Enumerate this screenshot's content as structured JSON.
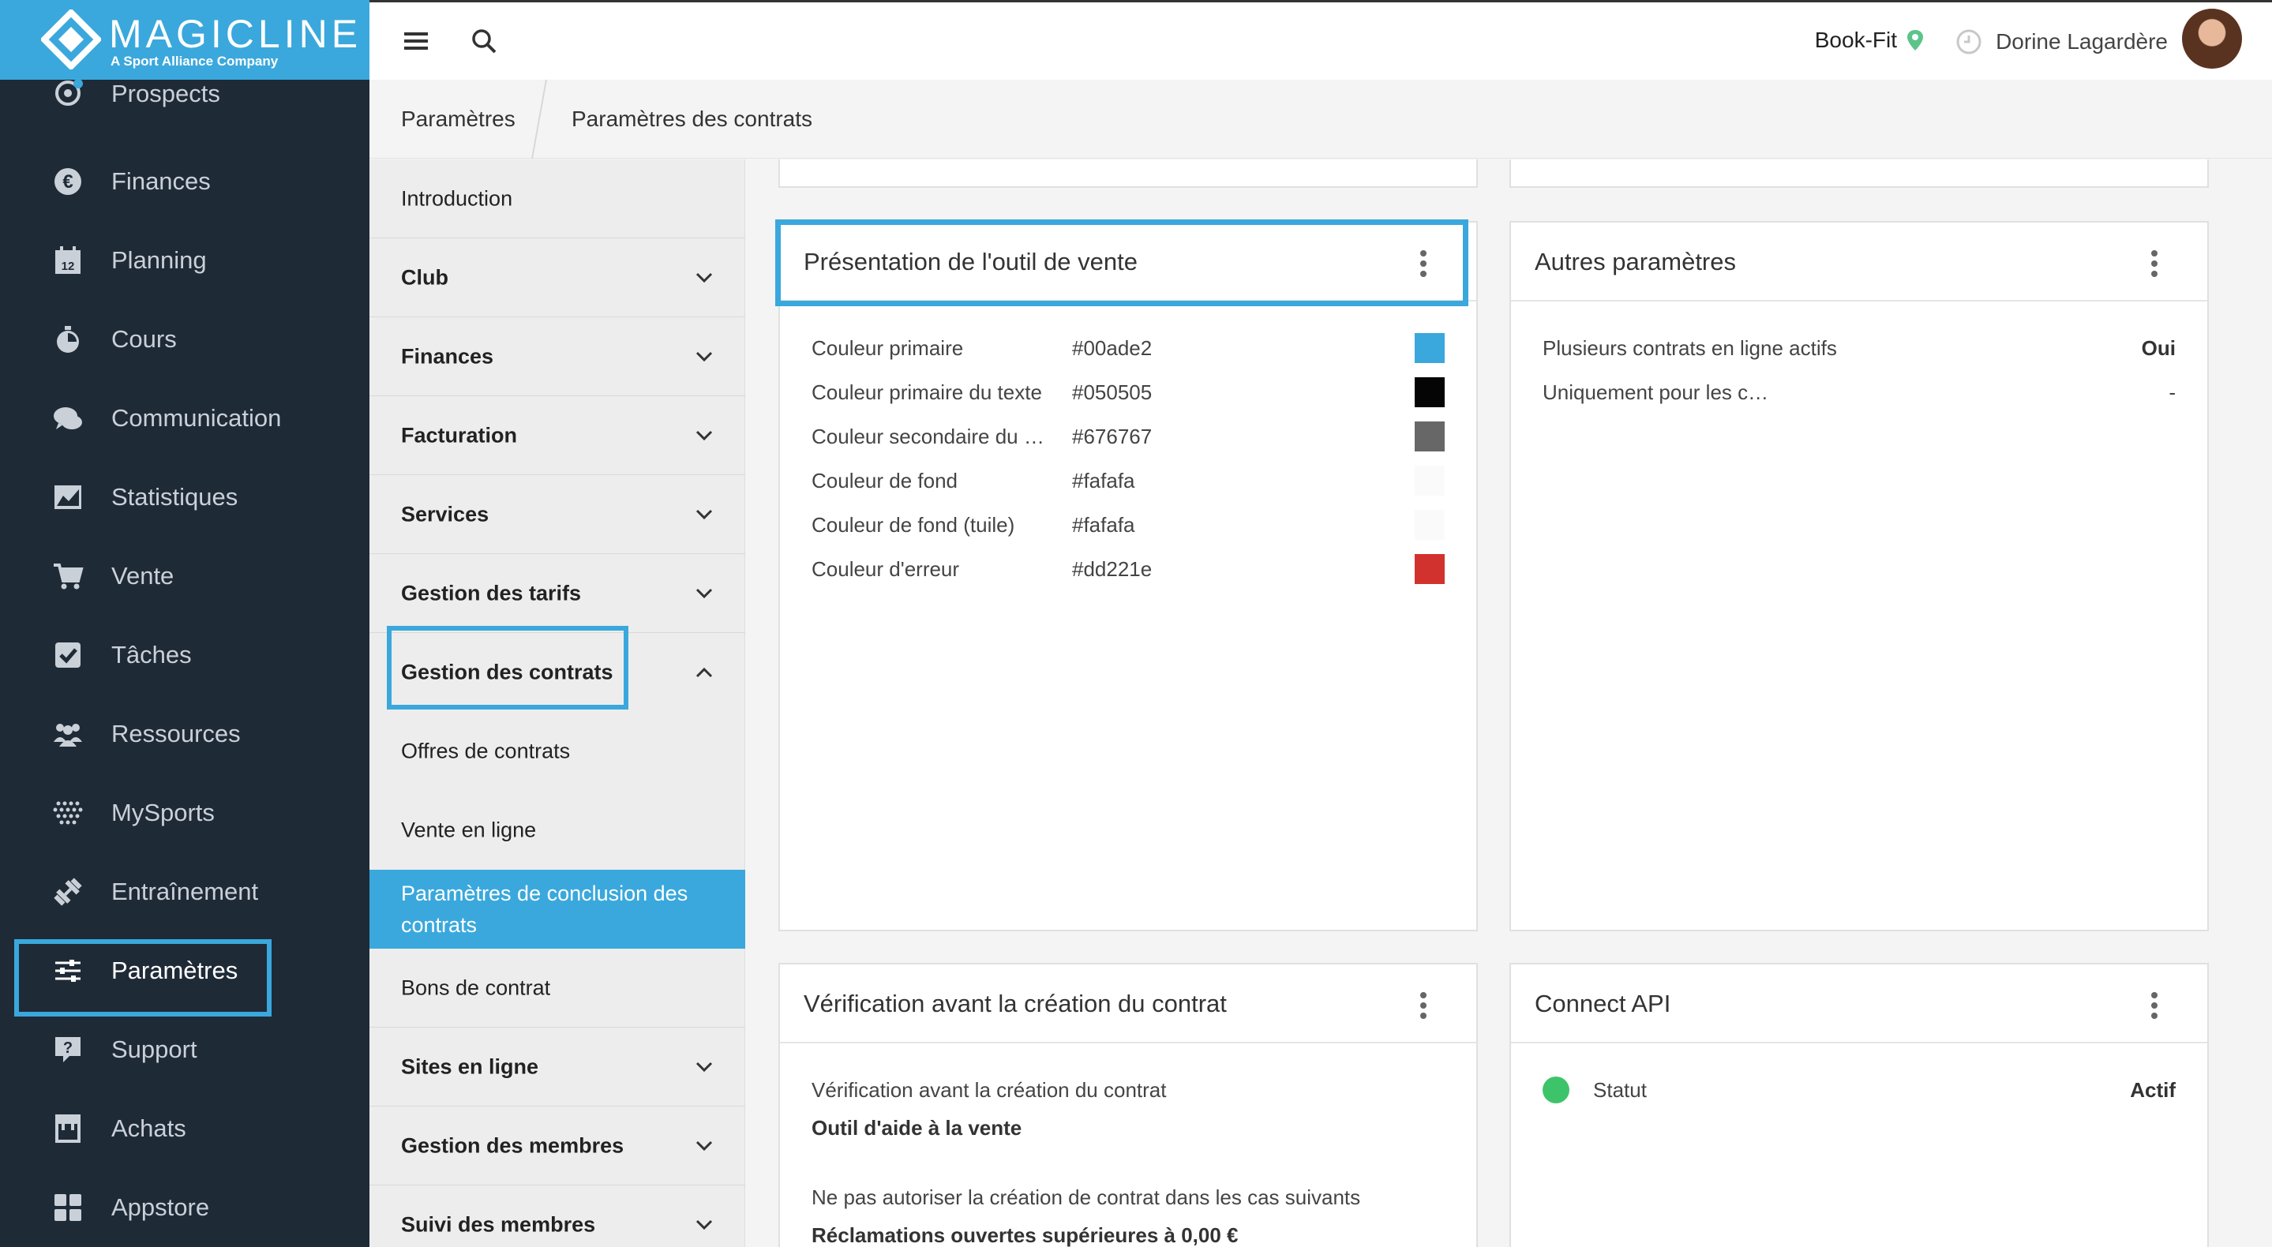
{
  "app": {
    "brand": "MAGICLINE",
    "brand_sub": "A Sport Alliance Company",
    "accent_color": "#3aa8dc",
    "sidebar_bg": "#1f2a37"
  },
  "nav": {
    "items": [
      {
        "label": "Prospects",
        "icon": "target-icon"
      },
      {
        "label": "Finances",
        "icon": "euro-icon"
      },
      {
        "label": "Planning",
        "icon": "calendar-icon"
      },
      {
        "label": "Cours",
        "icon": "stopwatch-icon"
      },
      {
        "label": "Communication",
        "icon": "chat-icon"
      },
      {
        "label": "Statistiques",
        "icon": "chart-icon"
      },
      {
        "label": "Vente",
        "icon": "cart-icon"
      },
      {
        "label": "Tâches",
        "icon": "checkbox-icon"
      },
      {
        "label": "Ressources",
        "icon": "people-icon"
      },
      {
        "label": "MySports",
        "icon": "dots-grid-icon"
      },
      {
        "label": "Entraînement",
        "icon": "dumbbell-icon"
      },
      {
        "label": "Paramètres",
        "icon": "sliders-icon"
      },
      {
        "label": "Support",
        "icon": "help-icon"
      },
      {
        "label": "Achats",
        "icon": "store-icon"
      },
      {
        "label": "Appstore",
        "icon": "apps-icon"
      }
    ]
  },
  "header": {
    "club": "Book-Fit",
    "user": "Dorine Lagardère"
  },
  "breadcrumb": {
    "level1": "Paramètres",
    "level2": "Paramètres des contrats"
  },
  "submenu": {
    "items": [
      {
        "label": "Introduction"
      },
      {
        "label": "Club"
      },
      {
        "label": "Finances"
      },
      {
        "label": "Facturation"
      },
      {
        "label": "Services"
      },
      {
        "label": "Gestion des tarifs"
      },
      {
        "label": "Gestion des contrats"
      },
      {
        "label": "Offres de contrats"
      },
      {
        "label": "Vente en ligne"
      },
      {
        "label": "Paramètres de conclusion des contrats"
      },
      {
        "label": "Bons de contrat"
      },
      {
        "label": "Sites en ligne"
      },
      {
        "label": "Gestion des membres"
      },
      {
        "label": "Suivi des membres"
      }
    ]
  },
  "cards": {
    "sales_tool": {
      "title": "Présentation de l'outil de vente",
      "rows": [
        {
          "label": "Couleur primaire",
          "value": "#00ade2",
          "swatch": "#3aa8dc"
        },
        {
          "label": "Couleur primaire du texte",
          "value": "#050505",
          "swatch": "#050505"
        },
        {
          "label": "Couleur secondaire du …",
          "value": "#676767",
          "swatch": "#676767"
        },
        {
          "label": "Couleur de fond",
          "value": "#fafafa",
          "swatch": "#fafafa"
        },
        {
          "label": "Couleur de fond (tuile)",
          "value": "#fafafa",
          "swatch": "#fafafa"
        },
        {
          "label": "Couleur d'erreur",
          "value": "#dd221e",
          "swatch": "#d2322d"
        }
      ]
    },
    "other": {
      "title": "Autres paramètres",
      "rows": [
        {
          "label": "Plusieurs contrats en ligne actifs",
          "value": "Oui"
        },
        {
          "label": "Uniquement pour les c…",
          "value": "-"
        }
      ]
    },
    "verification": {
      "title": "Vérification avant la création du contrat",
      "line1": "Vérification avant la création du contrat",
      "line2": "Outil d'aide à la vente",
      "line3": "Ne pas autoriser la création de contrat dans les cas suivants",
      "line4": "Réclamations ouvertes supérieures à 0,00 €"
    },
    "api": {
      "title": "Connect API",
      "status_label": "Statut",
      "status_value": "Actif",
      "status_color": "#3dc46a"
    }
  }
}
